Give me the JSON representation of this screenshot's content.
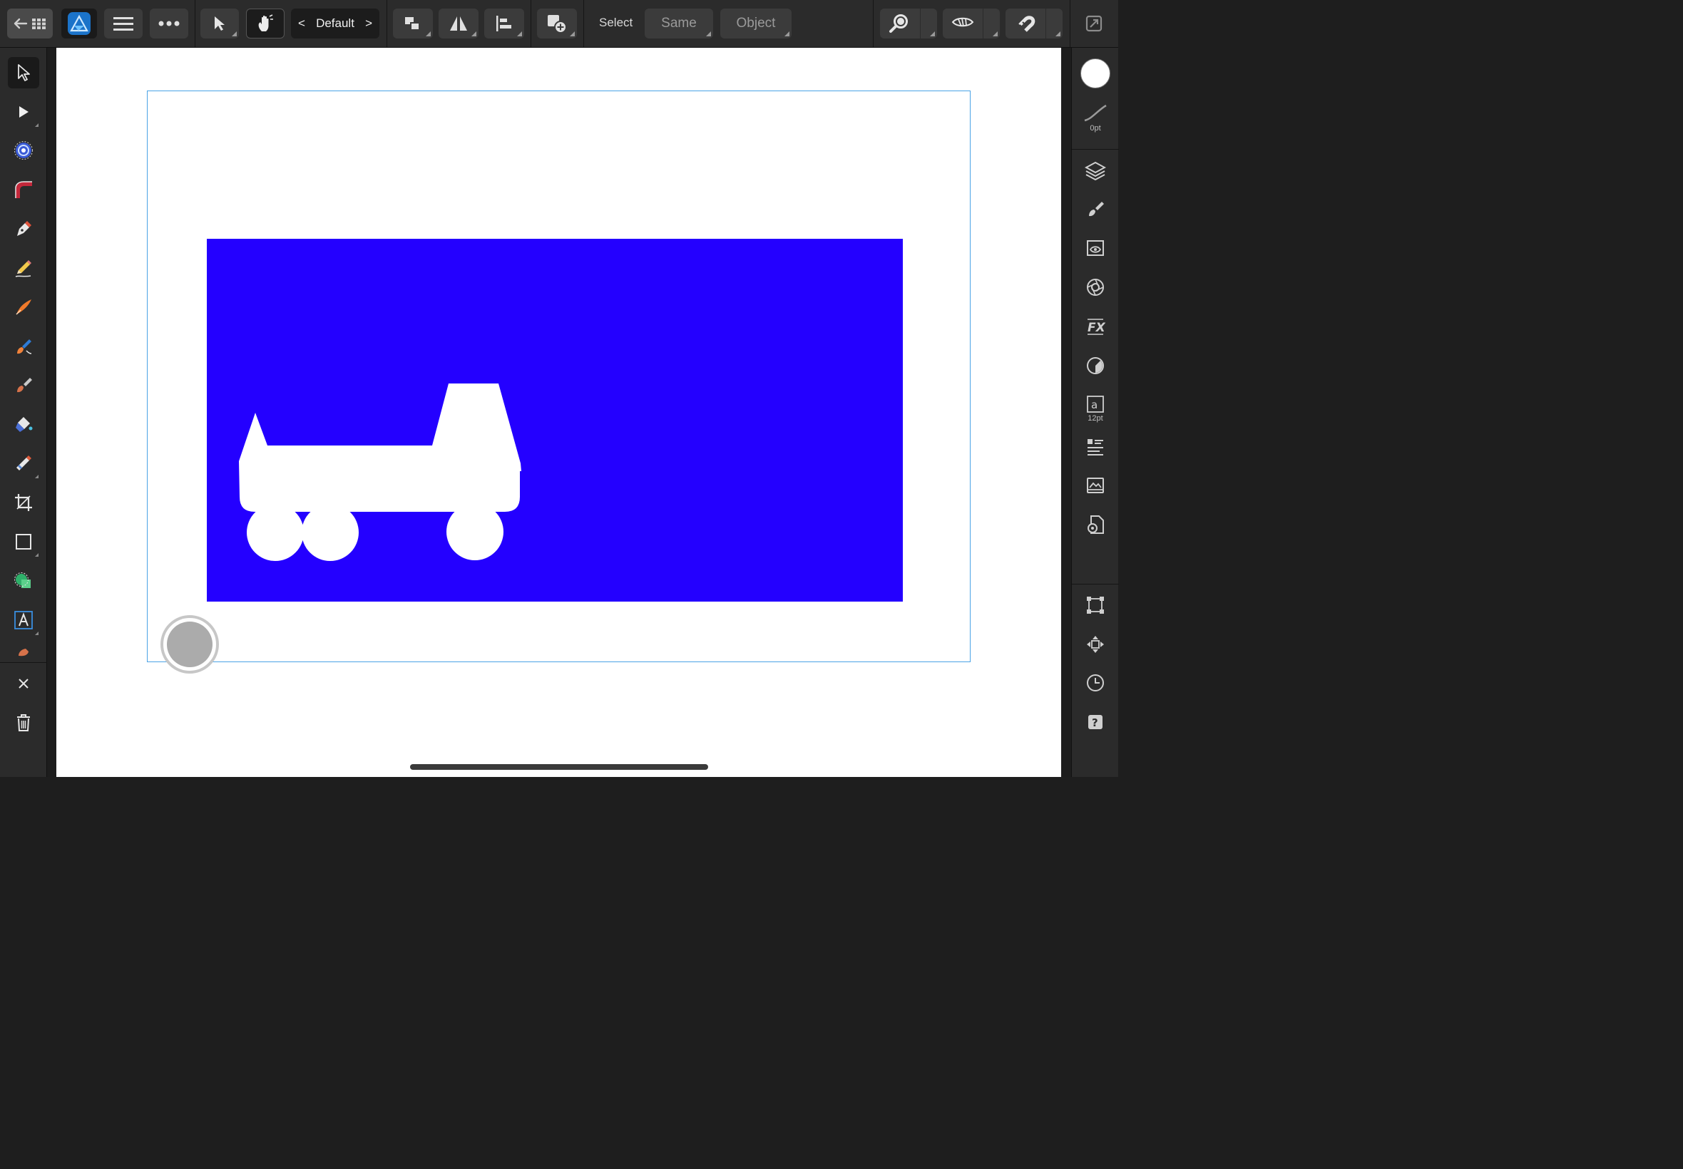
{
  "app": {
    "name": "Affinity Designer"
  },
  "toolbar": {
    "persona_label": "Default",
    "select_label": "Select",
    "same_label": "Same",
    "object_label": "Object"
  },
  "right_panel": {
    "stroke_width": "0pt",
    "text_size": "12pt"
  },
  "canvas": {
    "background_color": "#2400ff",
    "shape_color": "#ffffff",
    "artboard_border_color": "#4aa3e6"
  },
  "icons": {
    "left_tools": [
      "move-tool-icon",
      "node-tool-icon",
      "contour-tool-icon",
      "corner-tool-icon",
      "pen-tool-icon",
      "pencil-tool-icon",
      "vector-brush-icon",
      "brush-icon",
      "paint-brush-icon",
      "fill-tool-icon",
      "transparency-tool-icon",
      "crop-tool-icon",
      "rectangle-tool-icon",
      "shape-builder-icon",
      "text-tool-icon",
      "color-picker-icon"
    ],
    "right_studios": [
      "layers-icon",
      "brushes-icon",
      "stock-icon",
      "appearance-icon",
      "effects-icon",
      "styles-icon",
      "text-styles-icon",
      "paragraph-icon",
      "assets-icon",
      "document-settings-icon",
      "transform-icon",
      "navigator-icon",
      "history-icon",
      "help-icon"
    ]
  }
}
